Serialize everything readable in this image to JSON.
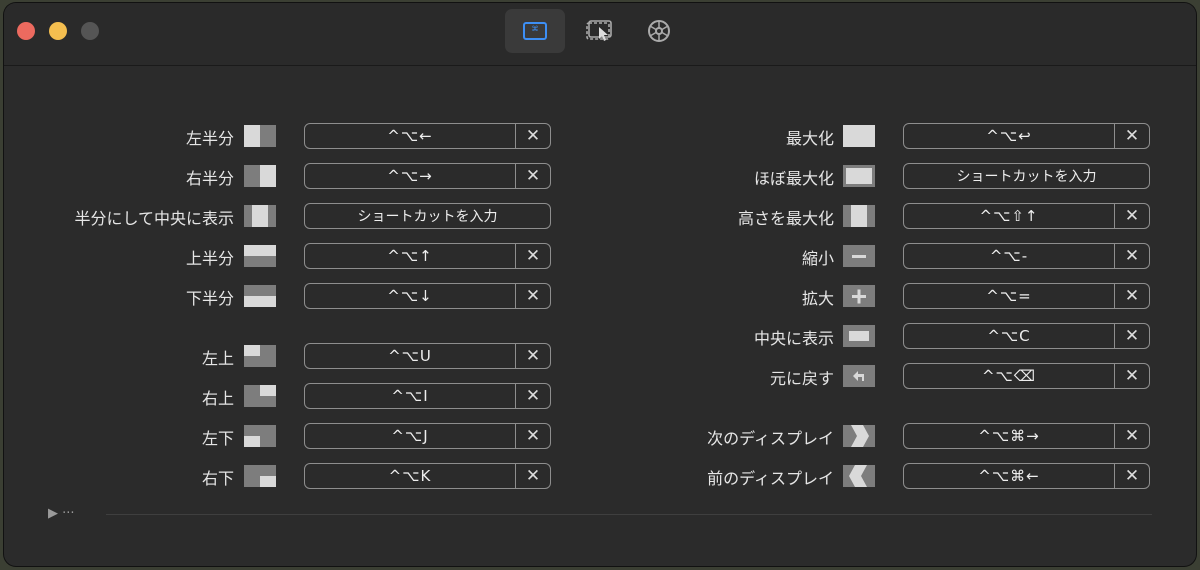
{
  "left": [
    {
      "label": "左半分",
      "value": "^⌥←",
      "clear": "✕",
      "icon": "left-half-icon"
    },
    {
      "label": "右半分",
      "value": "^⌥→",
      "clear": "✕",
      "icon": "right-half-icon"
    },
    {
      "label": "半分にして中央に表示",
      "value": "ショートカットを入力",
      "clear": "",
      "icon": "center-half-icon"
    },
    {
      "label": "上半分",
      "value": "^⌥↑",
      "clear": "✕",
      "icon": "top-half-icon"
    },
    {
      "label": "下半分",
      "value": "^⌥↓",
      "clear": "✕",
      "icon": "bottom-half-icon"
    },
    {
      "label": "左上",
      "value": "^⌥U",
      "clear": "✕",
      "icon": "top-left-icon"
    },
    {
      "label": "右上",
      "value": "^⌥I",
      "clear": "✕",
      "icon": "top-right-icon"
    },
    {
      "label": "左下",
      "value": "^⌥J",
      "clear": "✕",
      "icon": "bottom-left-icon"
    },
    {
      "label": "右下",
      "value": "^⌥K",
      "clear": "✕",
      "icon": "bottom-right-icon"
    }
  ],
  "right": [
    {
      "label": "最大化",
      "value": "^⌥↩",
      "clear": "✕",
      "icon": "maximize-icon"
    },
    {
      "label": "ほぼ最大化",
      "value": "ショートカットを入力",
      "clear": "",
      "icon": "almost-maximize-icon"
    },
    {
      "label": "高さを最大化",
      "value": "^⌥⇧↑",
      "clear": "✕",
      "icon": "maximize-height-icon"
    },
    {
      "label": "縮小",
      "value": "^⌥-",
      "clear": "✕",
      "icon": "shrink-icon"
    },
    {
      "label": "拡大",
      "value": "^⌥=",
      "clear": "✕",
      "icon": "enlarge-icon"
    },
    {
      "label": "中央に表示",
      "value": "^⌥C",
      "clear": "✕",
      "icon": "center-icon"
    },
    {
      "label": "元に戻す",
      "value": "^⌥⌫",
      "clear": "✕",
      "icon": "restore-icon"
    },
    {
      "label": "次のディスプレイ",
      "value": "^⌥⌘→",
      "clear": "✕",
      "icon": "next-display-icon"
    },
    {
      "label": "前のディスプレイ",
      "value": "^⌥⌘←",
      "clear": "✕",
      "icon": "prev-display-icon"
    }
  ],
  "footer": {
    "toggle": "▶ ···"
  }
}
